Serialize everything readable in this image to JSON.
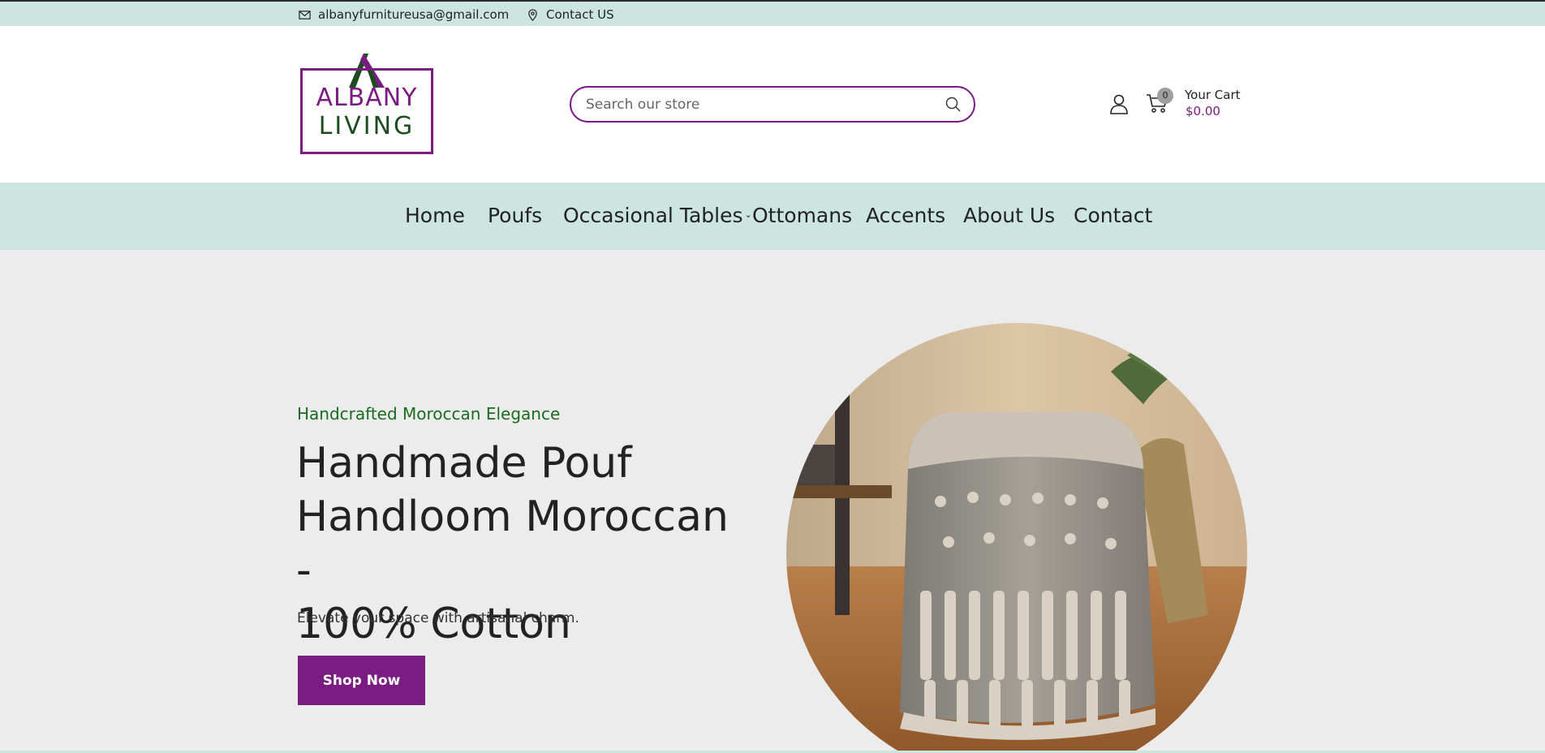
{
  "topbar": {
    "email": "albanyfurnitureusa@gmail.com",
    "contact": "Contact US",
    "email_icon": "mail-icon",
    "contact_icon": "map-pin-icon"
  },
  "header": {
    "logo": {
      "line1": "ALBANY",
      "line2": "LIVING"
    },
    "search": {
      "placeholder": "Search our store",
      "icon": "search-icon"
    },
    "account_icon": "user-icon",
    "cart": {
      "icon": "cart-icon",
      "count": "0",
      "label": "Your Cart",
      "total": "$0.00"
    }
  },
  "nav": {
    "items": [
      {
        "label": "Home"
      },
      {
        "label": "Poufs"
      },
      {
        "label": "Occasional Tables",
        "dropdown_icon": "chevron-down-icon"
      },
      {
        "label": "Ottomans"
      },
      {
        "label": "Accents"
      },
      {
        "label": "About Us"
      },
      {
        "label": "Contact"
      }
    ]
  },
  "hero": {
    "tagline": "Handcrafted Moroccan Elegance",
    "headline_lines": [
      "Handmade Pouf",
      "Handloom Moroccan -",
      "100% Cotton"
    ],
    "subtext": "Elevate your space with artisanal charm.",
    "cta": "Shop Now"
  },
  "colors": {
    "brand_purple": "#7a1c82",
    "brand_green": "#1a6b1e",
    "mint": "#cce5e0",
    "hero_bg": "#ececec"
  }
}
